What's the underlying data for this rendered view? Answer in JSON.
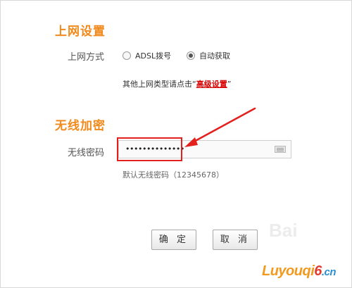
{
  "network": {
    "section_title": "上网设置",
    "mode_label": "上网方式",
    "options": [
      {
        "label": "ADSL拨号",
        "selected": false
      },
      {
        "label": "自动获取",
        "selected": true
      }
    ],
    "hint_prefix": "其他上网类型请点击“",
    "hint_link": "高级设置",
    "hint_suffix": "”"
  },
  "wireless": {
    "section_title": "无线加密",
    "password_label": "无线密码",
    "password_value": "••••••••••••••",
    "default_hint": "默认无线密码（12345678）"
  },
  "buttons": {
    "confirm": "确 定",
    "cancel": "取 消"
  },
  "watermark": {
    "main": "Luyouqi",
    "six": "6",
    "tail": ".cn",
    "baidu": "Bai"
  },
  "colors": {
    "section_title": "#f08a1c",
    "link": "#d80000",
    "annotation": "#e3201c"
  }
}
